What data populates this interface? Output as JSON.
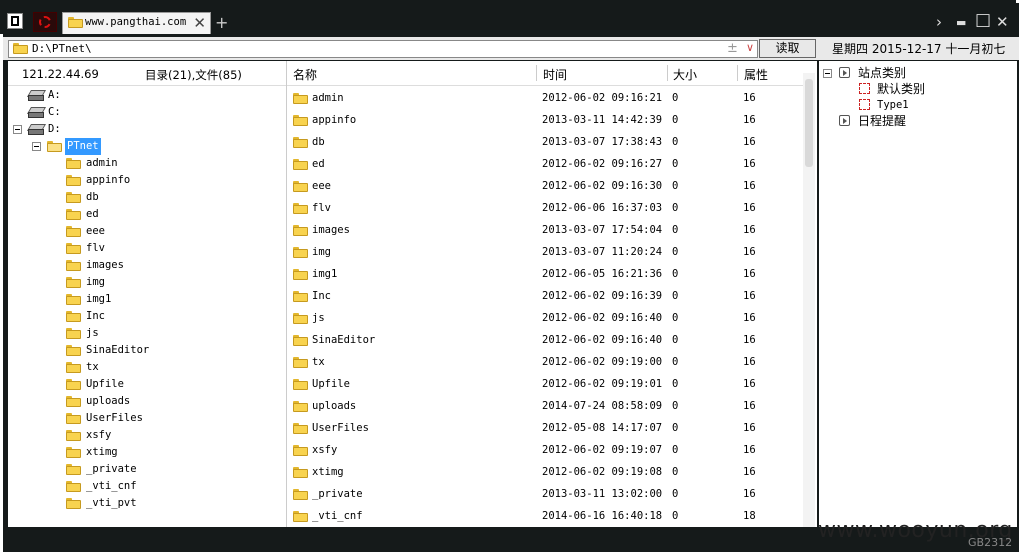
{
  "titlebar": {
    "tab_title": "www.pangthai.com",
    "tab_close": "✕",
    "new_tab": "+",
    "controls": {
      "forward": "›",
      "minimize": "▬",
      "maximize": "□",
      "close": "✕"
    }
  },
  "address": {
    "path": "D:\\PTnet\\",
    "add_glyph": "±",
    "dropdown_glyph": "∨",
    "read_button": "读取"
  },
  "date_label": "星期四 2015-12-17 十一月初七",
  "left": {
    "ip": "121.22.44.69",
    "counts": "目录(21),文件(85)",
    "drives": [
      "A:",
      "C:",
      "D:"
    ],
    "selected": "PTnet",
    "folders": [
      "admin",
      "appinfo",
      "db",
      "ed",
      "eee",
      "flv",
      "images",
      "img",
      "img1",
      "Inc",
      "js",
      "SinaEditor",
      "tx",
      "Upfile",
      "uploads",
      "UserFiles",
      "xsfy",
      "xtimg",
      "_private",
      "_vti_cnf",
      "_vti_pvt"
    ]
  },
  "list": {
    "headers": {
      "name": "名称",
      "time": "时间",
      "size": "大小",
      "attr": "属性"
    },
    "rows": [
      {
        "name": "admin",
        "time": "2012-06-02 09:16:21",
        "size": "0",
        "attr": "16"
      },
      {
        "name": "appinfo",
        "time": "2013-03-11 14:42:39",
        "size": "0",
        "attr": "16"
      },
      {
        "name": "db",
        "time": "2013-03-07 17:38:43",
        "size": "0",
        "attr": "16"
      },
      {
        "name": "ed",
        "time": "2012-06-02 09:16:27",
        "size": "0",
        "attr": "16"
      },
      {
        "name": "eee",
        "time": "2012-06-02 09:16:30",
        "size": "0",
        "attr": "16"
      },
      {
        "name": "flv",
        "time": "2012-06-06 16:37:03",
        "size": "0",
        "attr": "16"
      },
      {
        "name": "images",
        "time": "2013-03-07 17:54:04",
        "size": "0",
        "attr": "16"
      },
      {
        "name": "img",
        "time": "2013-03-07 11:20:24",
        "size": "0",
        "attr": "16"
      },
      {
        "name": "img1",
        "time": "2012-06-05 16:21:36",
        "size": "0",
        "attr": "16"
      },
      {
        "name": "Inc",
        "time": "2012-06-02 09:16:39",
        "size": "0",
        "attr": "16"
      },
      {
        "name": "js",
        "time": "2012-06-02 09:16:40",
        "size": "0",
        "attr": "16"
      },
      {
        "name": "SinaEditor",
        "time": "2012-06-02 09:16:40",
        "size": "0",
        "attr": "16"
      },
      {
        "name": "tx",
        "time": "2012-06-02 09:19:00",
        "size": "0",
        "attr": "16"
      },
      {
        "name": "Upfile",
        "time": "2012-06-02 09:19:01",
        "size": "0",
        "attr": "16"
      },
      {
        "name": "uploads",
        "time": "2014-07-24 08:58:09",
        "size": "0",
        "attr": "16"
      },
      {
        "name": "UserFiles",
        "time": "2012-05-08 14:17:07",
        "size": "0",
        "attr": "16"
      },
      {
        "name": "xsfy",
        "time": "2012-06-02 09:19:07",
        "size": "0",
        "attr": "16"
      },
      {
        "name": "xtimg",
        "time": "2012-06-02 09:19:08",
        "size": "0",
        "attr": "16"
      },
      {
        "name": "_private",
        "time": "2013-03-11 13:02:00",
        "size": "0",
        "attr": "16"
      },
      {
        "name": "_vti_cnf",
        "time": "2014-06-16 16:40:18",
        "size": "0",
        "attr": "18"
      }
    ]
  },
  "right": {
    "category_root": "站点类别",
    "categories": [
      "默认类别",
      "Type1"
    ],
    "schedule": "日程提醒"
  },
  "watermark": "www.wooyun.org",
  "corner_text": "GB2312"
}
